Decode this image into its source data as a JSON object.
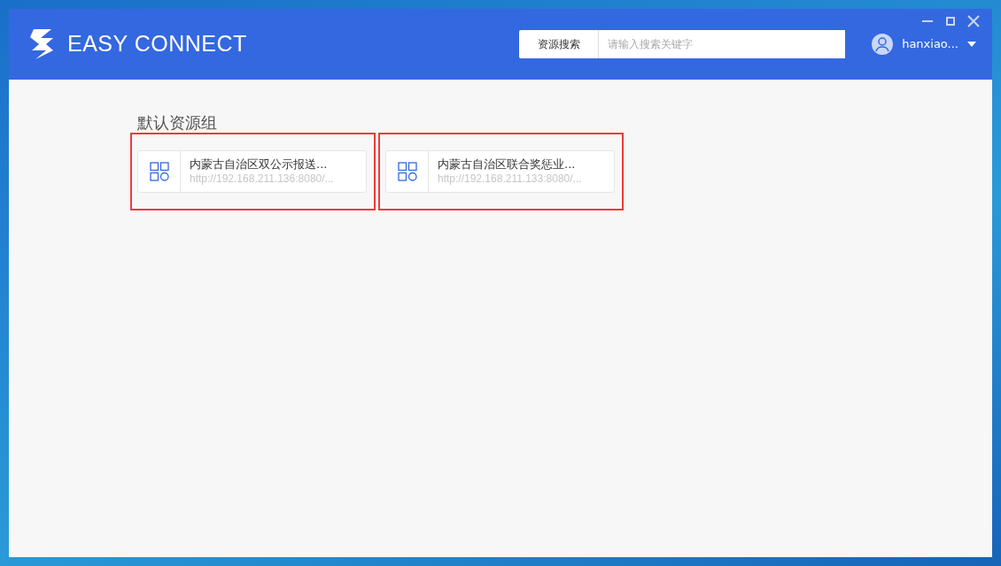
{
  "header": {
    "logo_text": "EASY CONNECT",
    "search": {
      "button": "资源搜索",
      "placeholder": "请输入搜索关键字"
    },
    "user": {
      "name": "hanxiao..."
    }
  },
  "group": {
    "title": "默认资源组",
    "resources": [
      {
        "name": "内蒙古自治区双公示报送...",
        "url": "http://192.168.211.136:8080/...",
        "highlighted": true
      },
      {
        "name": "内蒙古自治区联合奖惩业...",
        "url": "http://192.168.211.133:8080/...",
        "highlighted": true
      }
    ]
  }
}
